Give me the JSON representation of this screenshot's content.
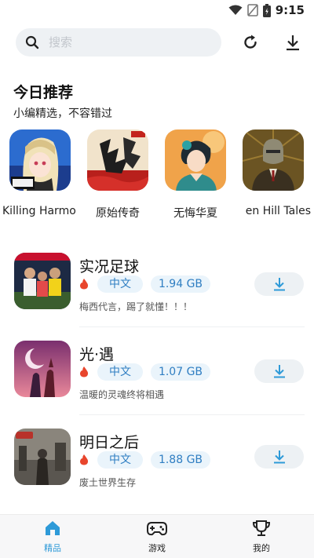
{
  "status": {
    "time": "9:15",
    "icons": [
      "wifi-icon",
      "sim-icon",
      "battery-icon"
    ]
  },
  "search": {
    "placeholder": "搜索",
    "icons": [
      "search-icon",
      "refresh-icon",
      "download-icon"
    ]
  },
  "recommend": {
    "title": "今日推荐",
    "subtitle": "小编精选，不容错过",
    "items": [
      {
        "label": "Killing Harmo"
      },
      {
        "label": "原始传奇"
      },
      {
        "label": "无悔华夏"
      },
      {
        "label": "en Hill Tales"
      }
    ]
  },
  "apps": [
    {
      "name": "实况足球",
      "lang": "中文",
      "size": "1.94 GB",
      "desc": "梅西代言，踢了就懂！！！"
    },
    {
      "name": "光·遇",
      "lang": "中文",
      "size": "1.07 GB",
      "desc": "温暖的灵魂终将相遇"
    },
    {
      "name": "明日之后",
      "lang": "中文",
      "size": "1.88 GB",
      "desc": "废土世界生存"
    }
  ],
  "nav": {
    "items": [
      {
        "label": "精品",
        "icon": "home-icon",
        "active": true
      },
      {
        "label": "游戏",
        "icon": "gamepad-icon",
        "active": false
      },
      {
        "label": "我的",
        "icon": "trophy-icon",
        "active": false
      }
    ],
    "active_color": "#2e9ad8"
  },
  "colors": {
    "accent": "#2e9ad8",
    "tag_bg": "#eaf4fb",
    "tag_text": "#2f7ec2",
    "fire": "#e8452c"
  }
}
